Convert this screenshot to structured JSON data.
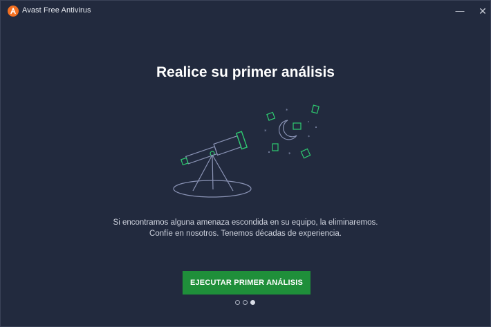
{
  "window": {
    "title": "Avast Free Antivirus",
    "minimize_glyph": "—",
    "close_glyph": "✕"
  },
  "main": {
    "headline": "Realice su primer análisis",
    "body_line1": "Si encontramos alguna amenaza escondida en su equipo, la eliminaremos.",
    "body_line2": "Confíe en nosotros. Tenemos décadas de experiencia.",
    "cta_label": "EJECUTAR PRIMER ANÁLISIS"
  },
  "pager": {
    "total": 3,
    "active_index": 3
  },
  "colors": {
    "background": "#222a3e",
    "accent_green": "#1f8f3a",
    "brand_orange": "#f37021",
    "illustration_line": "#8a93b5",
    "illustration_green": "#2ecc71"
  },
  "icons": [
    "avast-logo-icon",
    "minimize-icon",
    "close-icon",
    "telescope-illustration",
    "moon-icon",
    "document-icon",
    "star-icon"
  ]
}
